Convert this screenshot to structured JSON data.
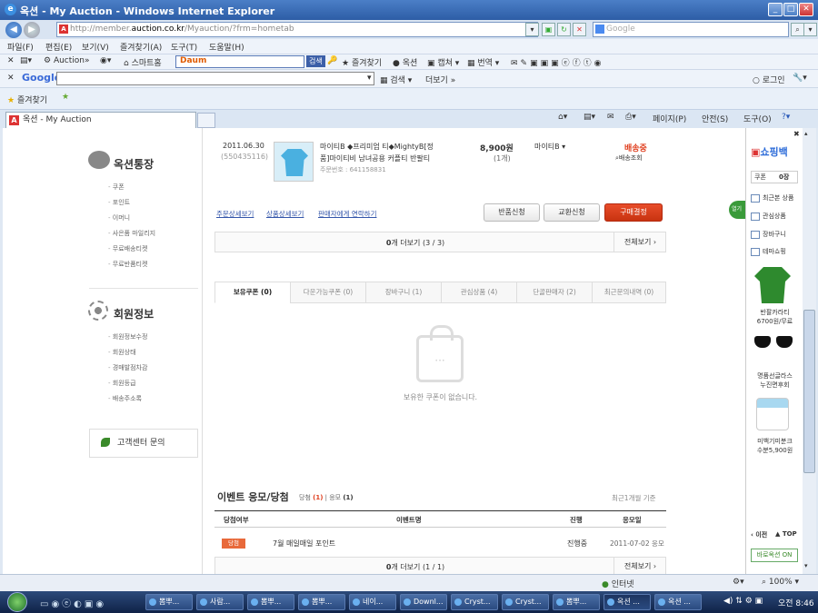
{
  "window": {
    "title": "옥션 - My Auction - Windows Internet Explorer",
    "address_host": "http://member.",
    "address_domain": "auction.co.kr",
    "address_path": "/Myauction/?frm=hometab",
    "search_placeholder": "Google"
  },
  "menu": [
    "파일(F)",
    "편집(E)",
    "보기(V)",
    "즐겨찾기(A)",
    "도구(T)",
    "도움말(H)"
  ],
  "toolbar1": {
    "auction": "Auction",
    "smarthome": "스마트홈",
    "daum_logo": "Daum",
    "daum_search_btn": "검색",
    "favorites": "즐겨찾기",
    "auction2": "옥션",
    "capture": "캡쳐",
    "translate": "번역"
  },
  "toolbar2": {
    "google_label": "Google",
    "search_btn": "검색",
    "more": "더보기 »",
    "login": "로그인"
  },
  "favbar": {
    "favorites": "즐겨찾기"
  },
  "tab": {
    "title": "옥션 - My Auction"
  },
  "cmdbar": {
    "page": "페이지(P)",
    "safety": "안전(S)",
    "tools": "도구(O)"
  },
  "sidebar": {
    "section1_title": "옥션통장",
    "section1_links": [
      "쿠폰",
      "포인트",
      "이머니",
      "사은품 마일리지",
      "무료배송티켓",
      "무료반품티켓"
    ],
    "section2_title": "회원정보",
    "section2_links": [
      "회원정보수정",
      "회원상태",
      "경매발점차감",
      "회원등급",
      "배송주소록"
    ],
    "cs": "고객센터 문의"
  },
  "order": {
    "date": "2011.06.30",
    "order_id": "(550435116)",
    "product_name_line1": "마이티B ◆프리미엄 티◆MightyB[정",
    "product_name_line2": "품]마이티비 남녀공용 커플티 반팔티",
    "order_no": "주문번호 : 641158831",
    "price": "8,900원",
    "qty": "(1개)",
    "option": "마이티B",
    "status": "배송중",
    "tracking": "배송조회",
    "link_order_detail": "주문상세보기",
    "link_product_detail": "상품상세보기",
    "link_seller_contact": "판매자에게 연락하기",
    "btn_return": "반품신청",
    "btn_exchange": "교환신청",
    "btn_confirm": "구매결정",
    "more_prefix": "0",
    "more_label": "개 더보기 (3 / 3)",
    "view_all": "전체보기"
  },
  "coupon_tabs": [
    "보유쿠폰 (0)",
    "다운가능쿠폰 (0)",
    "장바구니 (1)",
    "관심상품 (4)",
    "단골판매자 (2)",
    "최근문의내역 (0)"
  ],
  "empty_message": "보유한 쿠폰이 없습니다.",
  "empty_icon": "···",
  "events": {
    "title": "이벤트 응모/당첨",
    "win_label": "당첨",
    "win_count": "(1)",
    "apply_label": "응모",
    "apply_count": "(1)",
    "period_note": "최근1개월 기준",
    "headers": [
      "당첨여부",
      "이벤트명",
      "진행",
      "응모일"
    ],
    "rows": [
      {
        "badge": "당첨",
        "name": "7월 매일매일 포인트",
        "state": "진행중",
        "date": "2011-07-02 응모"
      }
    ],
    "more_prefix": "0",
    "more_label": "개 더보기 (1 / 1)",
    "view_all": "전체보기"
  },
  "right_panel": {
    "title": "쇼핑백",
    "coupon": "쿠폰",
    "coupon_count": "0장",
    "items": [
      "최근본 상품",
      "관심상품",
      "장바구니",
      "테마쇼핑"
    ],
    "product1": "반팔카라티",
    "product1_price": "6700원/무료",
    "product2": "명품선글라스",
    "product2_sub": "누진면후회",
    "product3": "미백기미분크",
    "product3_price": "수분5,900원",
    "prev": "‹ 이전",
    "top": "▲ TOP",
    "auction_on": "바로옥션 ON",
    "side_tab": "열기"
  },
  "statusbar": {
    "zone": "인터넷",
    "zoom": "100%"
  },
  "taskbar": {
    "items": [
      "뽐뿌...",
      "사람...",
      "뽐뿌...",
      "뽐뿌...",
      "네이...",
      "Downl...",
      "Cryst...",
      "Cryst...",
      "뽐뿌...",
      "옥션 ...",
      "옥션 ..."
    ],
    "time": "오전 8:46"
  }
}
